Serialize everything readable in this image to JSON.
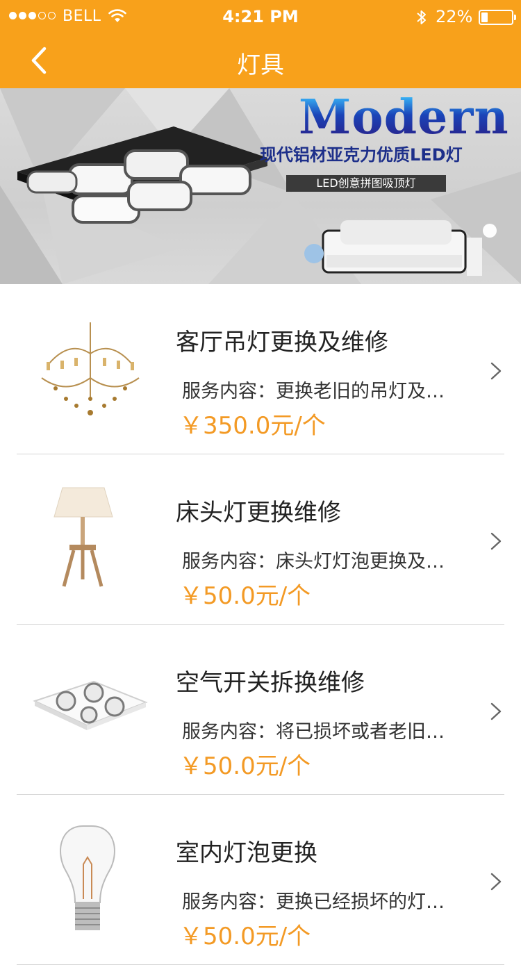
{
  "status_bar": {
    "carrier": "BELL",
    "time": "4:21 PM",
    "battery_percent": "22%",
    "battery_level": 0.22,
    "signal_bars_filled": 3,
    "signal_bars_total": 5
  },
  "nav": {
    "title": "灯具",
    "back_icon": "chevron-left-icon"
  },
  "banner": {
    "headline_en": "Modern",
    "headline_cn": "现代铝材亚克力优质LED灯",
    "tagline": "LED创意拼图吸顶灯"
  },
  "services": [
    {
      "title": "客厅吊灯更换及维修",
      "desc": "服务内容：更换老旧的吊灯及…",
      "price": "￥350.0元/个",
      "image": "chandelier"
    },
    {
      "title": "床头灯更换维修",
      "desc": "服务内容：床头灯灯泡更换及…",
      "price": "￥50.0元/个",
      "image": "table-lamp"
    },
    {
      "title": "空气开关拆换维修",
      "desc": "服务内容：将已损坏或者老旧…",
      "price": "￥50.0元/个",
      "image": "ceiling-heater-lamp"
    },
    {
      "title": "室内灯泡更换",
      "desc": "服务内容：更换已经损坏的灯…",
      "price": "￥50.0元/个",
      "image": "light-bulb"
    }
  ],
  "colors": {
    "accent": "#f8a11b",
    "price": "#f39a25",
    "divider": "#d5d5d5"
  }
}
